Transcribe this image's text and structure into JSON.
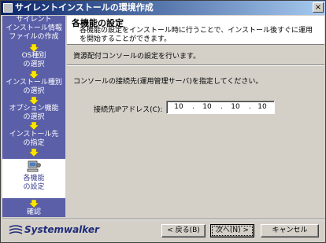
{
  "window": {
    "title": "サイレントインストールの環境作成",
    "close_label": "×"
  },
  "sidebar": {
    "steps": [
      {
        "label": "サイレント\nインストール情報\nファイルの作成"
      },
      {
        "label": "OS種別\nの選択"
      },
      {
        "label": "インストール種別\nの選択"
      },
      {
        "label": "オプション機能\nの選択"
      },
      {
        "label": "インストール先\nの指定"
      },
      {
        "label": "各機能\nの設定"
      },
      {
        "label": "確認"
      }
    ]
  },
  "header": {
    "title": "各機能の設定",
    "description": "各機能の設定をインストール時に行うことで、インストール後すぐに運用を開始することができます。"
  },
  "main": {
    "subtitle": "資源配付コンソールの設定を行います。",
    "instruction": "コンソールの接続先(運用管理サーバ)を指定してください。",
    "ip_label": "接続先IPアドレス(C):",
    "ip_octets": [
      "10",
      "10",
      "10",
      "10"
    ],
    "ip_dot": "."
  },
  "footer": {
    "logo_text": "Systemwalker",
    "back_label": "< 戻る(B)",
    "next_label": "次へ(N) >",
    "cancel_label": "キャンセル"
  },
  "colors": {
    "sidebar_bg": "#5a5fa8",
    "arrow": "#ffe600",
    "title_bar": "#0a246a"
  }
}
